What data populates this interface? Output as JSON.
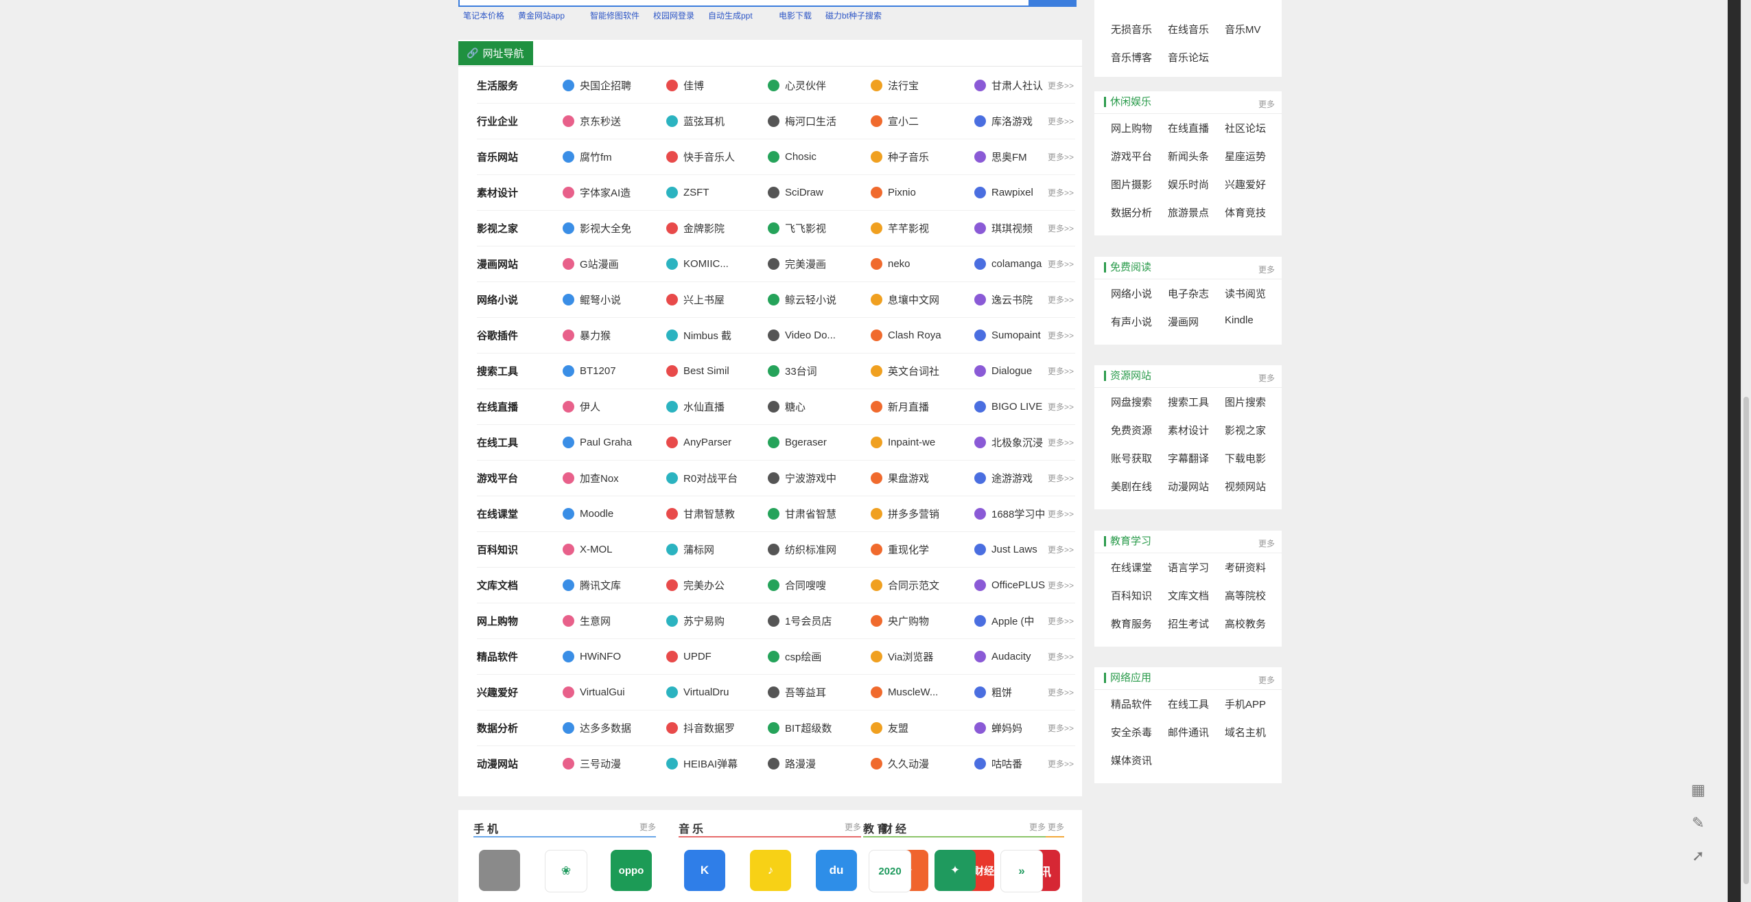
{
  "hot_links": [
    {
      "label": "笔记本价格"
    },
    {
      "label": "黄金网站app"
    },
    {
      "label": "智能修图软件"
    },
    {
      "label": "校园网登录"
    },
    {
      "label": "自动生成ppt"
    },
    {
      "label": "电影下载"
    },
    {
      "label": "磁力bt种子搜索"
    }
  ],
  "nav": {
    "title": "网址导航",
    "more_label": "更多>>",
    "rows": [
      {
        "category": "生活服务",
        "sites": [
          "央国企招聘",
          "佳博",
          "心灵伙伴",
          "法行宝",
          "甘肃人社认"
        ]
      },
      {
        "category": "行业企业",
        "sites": [
          "京东秒送",
          "蓝弦耳机",
          "梅河口生活",
          "宣小二",
          "库洛游戏"
        ]
      },
      {
        "category": "音乐网站",
        "sites": [
          "腐竹fm",
          "快手音乐人",
          "Chosic",
          "种子音乐",
          "思奥FM"
        ]
      },
      {
        "category": "素材设计",
        "sites": [
          "字体家AI造",
          "ZSFT",
          "SciDraw",
          "Pixnio",
          "Rawpixel"
        ]
      },
      {
        "category": "影视之家",
        "sites": [
          "影视大全免",
          "金牌影院",
          "飞飞影视",
          "芊芊影视",
          "琪琪视频"
        ]
      },
      {
        "category": "漫画网站",
        "sites": [
          "G站漫画",
          "KOMIIC...",
          "完美漫画",
          "neko",
          "colamanga"
        ]
      },
      {
        "category": "网络小说",
        "sites": [
          "鲲弩小说",
          "兴上书屋",
          "鲸云轻小说",
          "息壤中文网",
          "逸云书院"
        ]
      },
      {
        "category": "谷歌插件",
        "sites": [
          "暴力猴",
          "Nimbus 截",
          "Video Do...",
          "Clash Roya",
          "Sumopaint"
        ]
      },
      {
        "category": "搜索工具",
        "sites": [
          "BT1207",
          "Best Simil",
          "33台词",
          "英文台词社",
          "Dialogue"
        ]
      },
      {
        "category": "在线直播",
        "sites": [
          "伊人",
          "水仙直播",
          "糖心",
          "新月直播",
          "BIGO LIVE"
        ]
      },
      {
        "category": "在线工具",
        "sites": [
          "Paul Graha",
          "AnyParser",
          "Bgeraser",
          "Inpaint-we",
          "北极象沉浸"
        ]
      },
      {
        "category": "游戏平台",
        "sites": [
          "加查Nox",
          "R0对战平台",
          "宁波游戏中",
          "果盘游戏",
          "途游游戏"
        ]
      },
      {
        "category": "在线课堂",
        "sites": [
          "Moodle",
          "甘肃智慧教",
          "甘肃省智慧",
          "拼多多营销",
          "1688学习中"
        ]
      },
      {
        "category": "百科知识",
        "sites": [
          "X-MOL",
          "蒲标网",
          "纺织标准网",
          "重现化学",
          "Just Laws"
        ]
      },
      {
        "category": "文库文档",
        "sites": [
          "腾讯文库",
          "完美办公",
          "合同嗖嗖",
          "合同示范文",
          "OfficePLUS"
        ]
      },
      {
        "category": "网上购物",
        "sites": [
          "生意网",
          "苏宁易购",
          "1号会员店",
          "央广购物",
          "Apple (中"
        ]
      },
      {
        "category": "精品软件",
        "sites": [
          "HWiNFO",
          "UPDF",
          "csp绘画",
          "Via浏览器",
          "Audacity"
        ]
      },
      {
        "category": "兴趣爱好",
        "sites": [
          "VirtualGui",
          "VirtualDru",
          "吾等益耳",
          "MuscleW...",
          "粗饼"
        ]
      },
      {
        "category": "数据分析",
        "sites": [
          "达多多数据",
          "抖音数据罗",
          "BIT超级数",
          "友盟",
          "蝉妈妈"
        ]
      },
      {
        "category": "动漫网站",
        "sites": [
          "三号动漫",
          "HEIBAI弹幕",
          "路漫漫",
          "久久动漫",
          "咕咕番"
        ]
      }
    ]
  },
  "sidebar": {
    "more_label": "更多",
    "music_items": [
      "无损音乐",
      "在线音乐",
      "音乐MV",
      "音乐博客",
      "音乐论坛"
    ],
    "panels": [
      {
        "title": "休闲娱乐",
        "items": [
          "网上购物",
          "在线直播",
          "社区论坛",
          "游戏平台",
          "新闻头条",
          "星座运势",
          "图片摄影",
          "娱乐时尚",
          "兴趣爱好",
          "数据分析",
          "旅游景点",
          "体育竞技"
        ]
      },
      {
        "title": "免费阅读",
        "items": [
          "网络小说",
          "电子杂志",
          "读书阅览",
          "有声小说",
          "漫画网",
          "Kindle"
        ]
      },
      {
        "title": "资源网站",
        "items": [
          "网盘搜索",
          "搜索工具",
          "图片搜索",
          "免费资源",
          "素材设计",
          "影视之家",
          "账号获取",
          "字幕翻译",
          "下载电影",
          "美剧在线",
          "动漫网站",
          "视频网站"
        ]
      },
      {
        "title": "教育学习",
        "items": [
          "在线课堂",
          "语言学习",
          "考研资料",
          "百科知识",
          "文库文档",
          "高等院校",
          "教育服务",
          "招生考试",
          "高校教务"
        ]
      },
      {
        "title": "网络应用",
        "items": [
          "精品软件",
          "在线工具",
          "手机APP",
          "安全杀毒",
          "邮件通讯",
          "域名主机",
          "媒体资讯"
        ]
      }
    ]
  },
  "apps": {
    "more_label": "更多",
    "columns": [
      {
        "title": "手机",
        "color": "#6aa7e8",
        "icons": [
          {
            "name": "apple-icon",
            "glyph": "",
            "bg": "#8a8a8a"
          },
          {
            "name": "huawei-icon",
            "glyph": "❀",
            "bg": "#ffffff"
          },
          {
            "name": "oppo-icon",
            "glyph": "oppo",
            "bg": "#1c9b56"
          }
        ]
      },
      {
        "title": "音乐",
        "color": "#e66b6b",
        "icons": [
          {
            "name": "kugou-icon",
            "glyph": "K",
            "bg": "#2f7ee8"
          },
          {
            "name": "qqmusic-icon",
            "glyph": "♪",
            "bg": "#f7d116"
          },
          {
            "name": "baidu-music-icon",
            "glyph": "du",
            "bg": "#2e8ee8"
          }
        ]
      },
      {
        "title": "财经",
        "color": "#f2a93b",
        "icons": [
          {
            "name": "tonghuashun-icon",
            "glyph": "✈",
            "bg": "#f0642d"
          },
          {
            "name": "sina-finance-icon",
            "glyph": "新浪财经",
            "bg": "#e8372c"
          },
          {
            "name": "hexun-icon",
            "glyph": "和讯",
            "bg": "#d62734"
          }
        ]
      },
      {
        "title": "教育",
        "color": "#8cc56a",
        "icons": [
          {
            "name": "edu-2020-icon",
            "glyph": "2020",
            "bg": "#ffffff"
          },
          {
            "name": "edu-leaf-icon",
            "glyph": "✦",
            "bg": "#1f9a5e"
          },
          {
            "name": "edu-arrow-icon",
            "glyph": "»",
            "bg": "#ffffff"
          }
        ]
      }
    ]
  },
  "float_tools": [
    {
      "name": "qrcode-icon",
      "glyph": "▦"
    },
    {
      "name": "feedback-icon",
      "glyph": "✎"
    },
    {
      "name": "back-to-top-icon",
      "glyph": "➚"
    }
  ]
}
